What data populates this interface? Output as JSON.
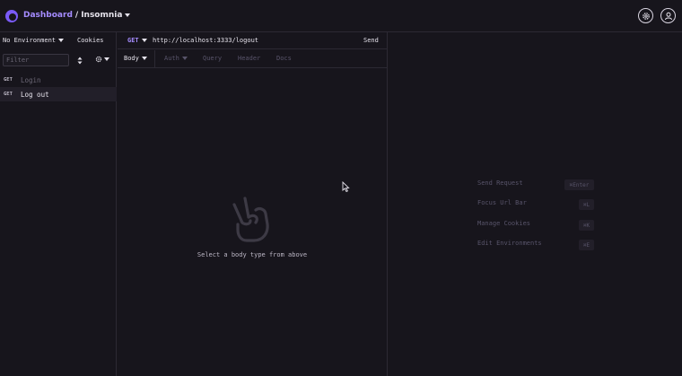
{
  "header": {
    "breadcrumb_link": "Dashboard",
    "separator": "/",
    "current": "Insomnia",
    "accent": "#a58cff"
  },
  "sidebar": {
    "environment": "No Environment",
    "cookies": "Cookies",
    "filter_placeholder": "Filter",
    "requests": [
      {
        "method": "GET",
        "name": "Login"
      },
      {
        "method": "GET",
        "name": "Log out"
      }
    ]
  },
  "request": {
    "method": "GET",
    "url": "http://localhost:3333/logout",
    "send": "Send",
    "tabs": [
      "Body",
      "Auth",
      "Query",
      "Header",
      "Docs"
    ],
    "empty_message": "Select a body type from above"
  },
  "response": {
    "shortcuts": [
      {
        "label": "Send Request",
        "key": "⌘Enter"
      },
      {
        "label": "Focus Url Bar",
        "key": "⌘L"
      },
      {
        "label": "Manage Cookies",
        "key": "⌘K"
      },
      {
        "label": "Edit Environments",
        "key": "⌘E"
      }
    ]
  }
}
